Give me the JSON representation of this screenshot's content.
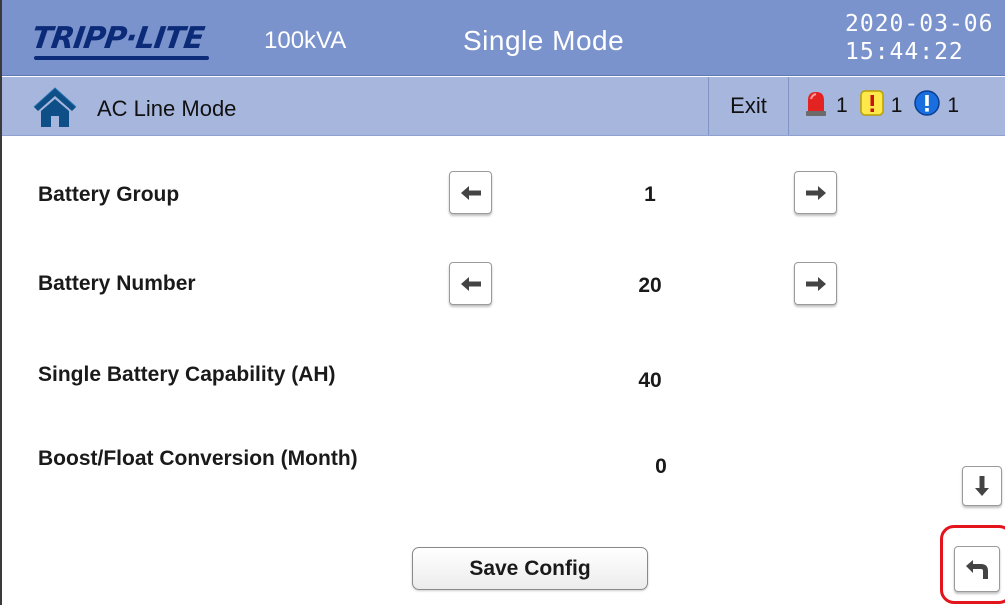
{
  "header": {
    "logo_text": "TRIPP·LITE",
    "model": "100kVA",
    "mode": "Single Mode",
    "date": "2020-03-06",
    "time": "15:44:22"
  },
  "statusbar": {
    "status": "AC Line Mode",
    "exit_label": "Exit",
    "alarms": [
      {
        "type": "alarm-siren",
        "count": "1"
      },
      {
        "type": "warning",
        "count": "1"
      },
      {
        "type": "info",
        "count": "1"
      }
    ]
  },
  "settings": [
    {
      "label": "Battery Group",
      "value": "1"
    },
    {
      "label": "Battery Number",
      "value": "20"
    },
    {
      "label": "Single Battery Capability (AH)",
      "value": "40"
    },
    {
      "label": "Boost/Float Conversion (Month)",
      "value": "0"
    }
  ],
  "buttons": {
    "save_label": "Save Config"
  },
  "colors": {
    "header_bg": "#7b93cc",
    "statusbar_bg": "#a6b6dd",
    "logo": "#0b2a78",
    "highlight": "#e3141b"
  },
  "icons": {
    "home": "home-icon",
    "left": "arrow-left-icon",
    "right": "arrow-right-icon",
    "down": "arrow-down-icon",
    "back": "back-return-icon"
  }
}
